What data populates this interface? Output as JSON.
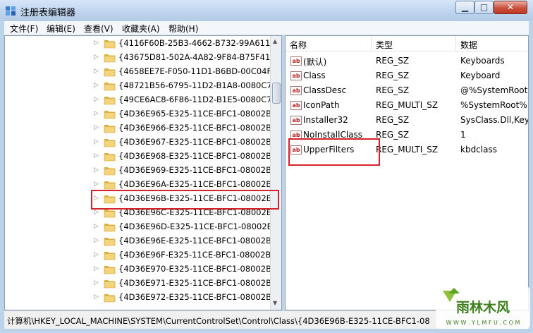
{
  "window": {
    "title": "注册表编辑器",
    "minimize": "▁",
    "maximize": "□",
    "close": "✕"
  },
  "menu": [
    {
      "label": "文件(F)"
    },
    {
      "label": "编辑(E)"
    },
    {
      "label": "查看(V)"
    },
    {
      "label": "收藏夹(A)"
    },
    {
      "label": "帮助(H)"
    }
  ],
  "tree": {
    "items": [
      {
        "label": "{4116F60B-25B3-4662-B732-99A6111",
        "selected": false
      },
      {
        "label": "{43675D81-502A-4A82-9F84-B75F418",
        "selected": false
      },
      {
        "label": "{4658EE7E-F050-11D1-B6BD-00C04FA",
        "selected": false
      },
      {
        "label": "{48721B56-6795-11D2-B1A8-0080C72",
        "selected": false
      },
      {
        "label": "{49CE6AC8-6F86-11D2-B1E5-0080C72",
        "selected": false
      },
      {
        "label": "{4D36E965-E325-11CE-BFC1-08002BE",
        "selected": false
      },
      {
        "label": "{4D36E966-E325-11CE-BFC1-08002BE",
        "selected": false
      },
      {
        "label": "{4D36E967-E325-11CE-BFC1-08002BE",
        "selected": false
      },
      {
        "label": "{4D36E968-E325-11CE-BFC1-08002BE",
        "selected": false
      },
      {
        "label": "{4D36E969-E325-11CE-BFC1-08002BE",
        "selected": false
      },
      {
        "label": "{4D36E96A-E325-11CE-BFC1-08002BE",
        "selected": false
      },
      {
        "label": "{4D36E96B-E325-11CE-BFC1-08002BE",
        "selected": true
      },
      {
        "label": "{4D36E96C-E325-11CE-BFC1-08002BE",
        "selected": false
      },
      {
        "label": "{4D36E96D-E325-11CE-BFC1-08002BE",
        "selected": false
      },
      {
        "label": "{4D36E96E-E325-11CE-BFC1-08002BE",
        "selected": false
      },
      {
        "label": "{4D36E96F-E325-11CE-BFC1-08002BE",
        "selected": false
      },
      {
        "label": "{4D36E970-E325-11CE-BFC1-08002BE",
        "selected": false
      },
      {
        "label": "{4D36E971-E325-11CE-BFC1-08002BE",
        "selected": false
      },
      {
        "label": "{4D36E972-E325-11CE-BFC1-08002BE",
        "selected": false
      }
    ]
  },
  "values": {
    "columns": {
      "name": "名称",
      "type": "类型",
      "data": "数据"
    },
    "rows": [
      {
        "name": "(默认)",
        "type": "REG_SZ",
        "data": "Keyboards"
      },
      {
        "name": "Class",
        "type": "REG_SZ",
        "data": "Keyboard"
      },
      {
        "name": "ClassDesc",
        "type": "REG_SZ",
        "data": "@%SystemRoot"
      },
      {
        "name": "IconPath",
        "type": "REG_MULTI_SZ",
        "data": "%SystemRoot%"
      },
      {
        "name": "Installer32",
        "type": "REG_SZ",
        "data": "SysClass.Dll,Key"
      },
      {
        "name": "NoInstallClass",
        "type": "REG_SZ",
        "data": "1"
      },
      {
        "name": "UpperFilters",
        "type": "REG_MULTI_SZ",
        "data": "kbdclass"
      }
    ],
    "icon_label": "ab"
  },
  "status": {
    "path": "计算机\\HKEY_LOCAL_MACHINE\\SYSTEM\\CurrentControlSet\\Control\\Class\\{4D36E96B-E325-11CE-BFC1-08"
  },
  "watermark": {
    "brand": "雨林木风",
    "url": "W W W . Y L M F U . C O M"
  },
  "colors": {
    "highlight_box": "#d8222b",
    "title_gradient": "#bfd5ee",
    "folder": "#f1c95a"
  }
}
